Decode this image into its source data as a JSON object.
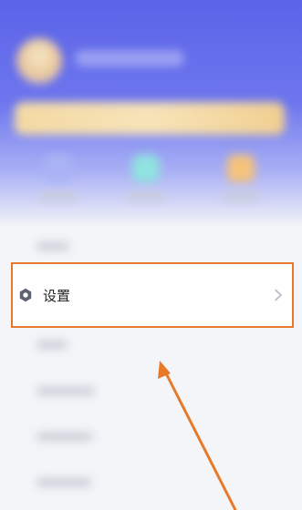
{
  "menu": {
    "settings_label": "设置"
  },
  "icons": {
    "settings": "gear-icon",
    "chevron": "chevron-right-icon"
  },
  "colors": {
    "header_blue": "#5b63e8",
    "highlight_orange": "#e8782a",
    "quick_icon_1": "#aab3f4",
    "quick_icon_2": "#8fe3df",
    "quick_icon_3": "#f6c27a"
  }
}
